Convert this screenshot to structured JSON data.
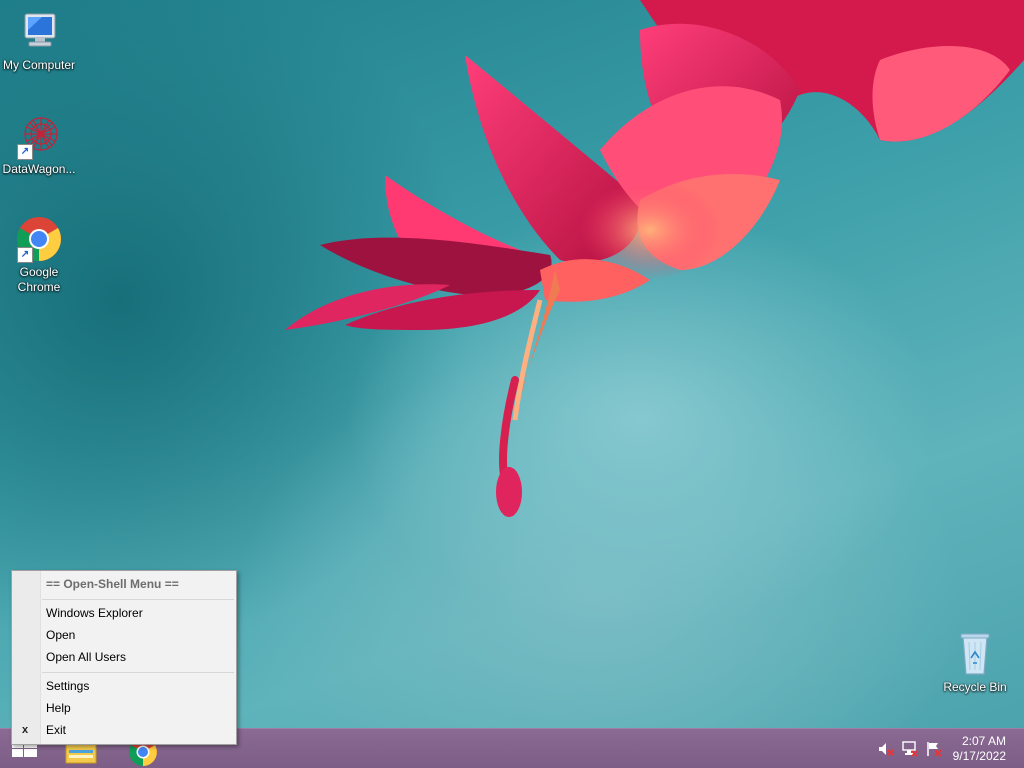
{
  "desktop": {
    "icons": [
      {
        "label": "My Computer"
      },
      {
        "label": "DataWagon..."
      },
      {
        "label": "Google\nChrome"
      },
      {
        "label": "Recycle Bin"
      }
    ]
  },
  "context_menu": {
    "title": "== Open-Shell Menu ==",
    "items": [
      {
        "label": "Windows Explorer"
      },
      {
        "label": "Open"
      },
      {
        "label": "Open All Users"
      },
      {
        "label": "Settings"
      },
      {
        "label": "Help"
      },
      {
        "label": "Exit"
      }
    ],
    "exit_marker": "x"
  },
  "taskbar": {
    "pinned": [
      {
        "icon": "file-explorer-icon"
      },
      {
        "icon": "chrome-icon"
      }
    ],
    "tray": {
      "icons": [
        "speaker-muted-icon",
        "network-icon",
        "action-center-flag-icon"
      ]
    },
    "clock": {
      "time": "2:07 AM",
      "date": "9/17/2022"
    }
  },
  "colors": {
    "taskbar": "#7c5d86",
    "menu_bg": "#f2f2f2",
    "flower": "#e0245e"
  }
}
